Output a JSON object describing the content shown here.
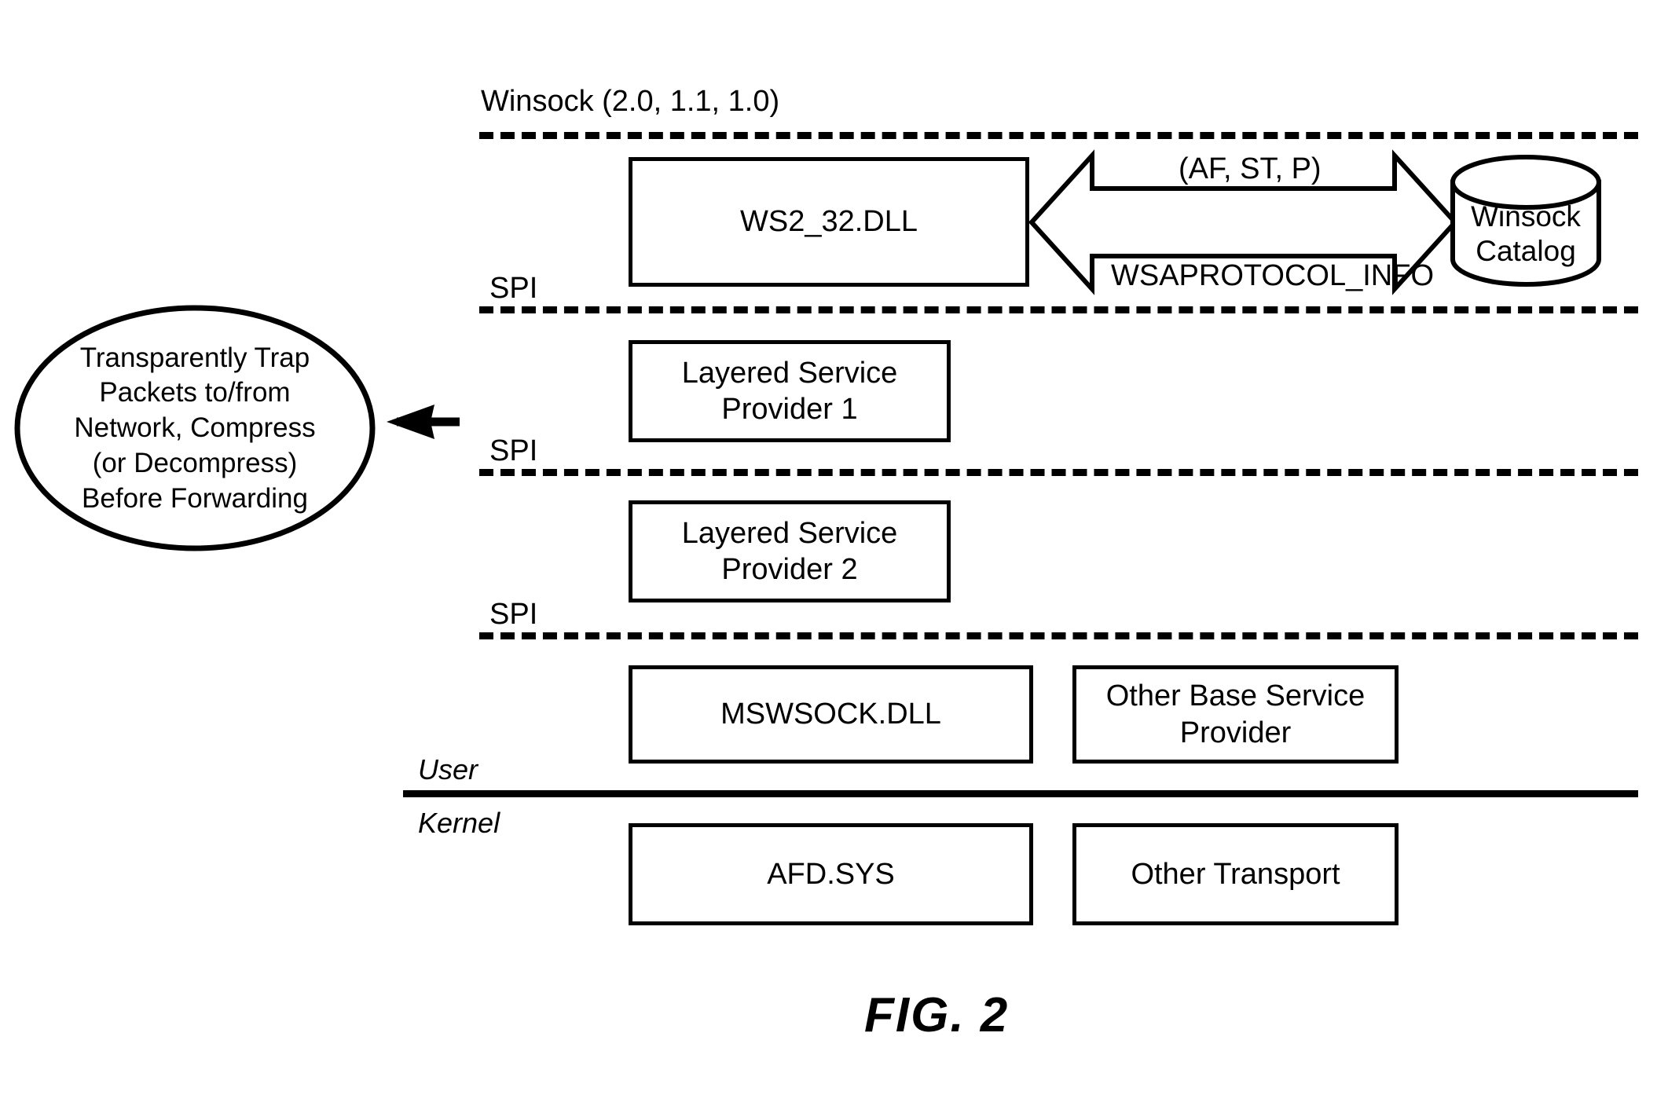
{
  "figure": {
    "caption": "FIG. 2"
  },
  "layers": {
    "top_label": "Winsock (2.0, 1.1, 1.0)",
    "spi_1": "SPI",
    "spi_2": "SPI",
    "spi_3": "SPI",
    "user_label": "User",
    "kernel_label": "Kernel"
  },
  "boxes": {
    "ws2_32": "WS2_32.DLL",
    "lsp1_line1": "Layered Service",
    "lsp1_line2": "Provider 1",
    "lsp2_line1": "Layered Service",
    "lsp2_line2": "Provider 2",
    "mswsock": "MSWSOCK.DLL",
    "other_base_line1": "Other Base Service",
    "other_base_line2": "Provider",
    "afd_sys": "AFD.SYS",
    "other_transport": "Other Transport"
  },
  "catalog": {
    "line1": "Winsock",
    "line2": "Catalog"
  },
  "arrows": {
    "top_label": "(AF, ST, P)",
    "bottom_label": "WSAPROTOCOL_INFO"
  },
  "callout": {
    "line1": "Transparently Trap",
    "line2": "Packets to/from",
    "line3": "Network, Compress",
    "line4": "(or Decompress)",
    "line5": "Before Forwarding"
  },
  "colors": {
    "stroke": "#000000",
    "background": "#ffffff"
  }
}
